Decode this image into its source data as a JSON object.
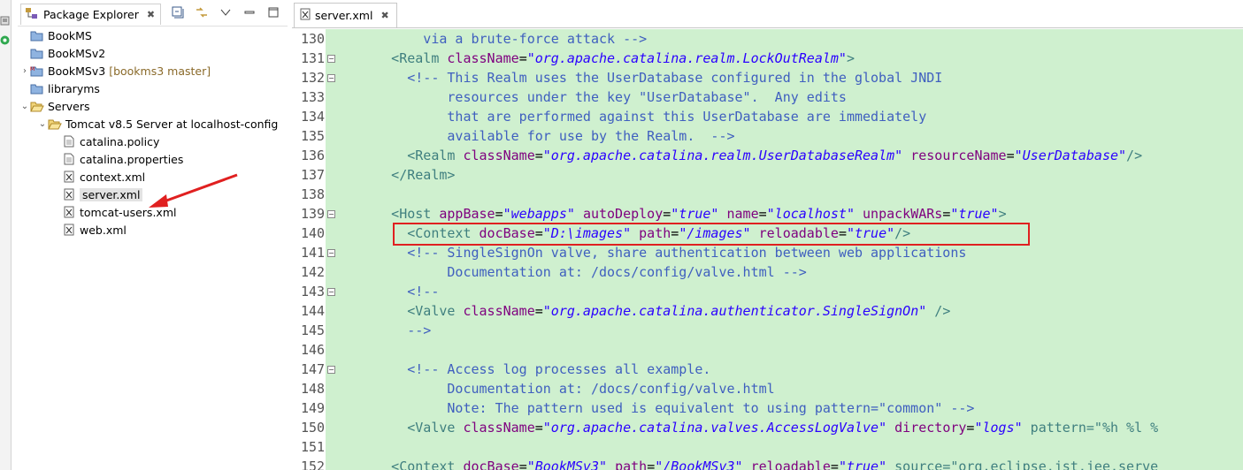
{
  "left_strip": {
    "icons": [
      "launch-icon",
      "run-status-icon"
    ]
  },
  "package_explorer": {
    "title": "Package Explorer",
    "close": "✖",
    "toolbar": [
      "collapse-all-icon",
      "link-editor-icon",
      "view-menu-icon",
      "minimize-icon",
      "maximize-icon"
    ],
    "tree": [
      {
        "label": "BookMS",
        "icon": "project-folder-icon",
        "decor": ""
      },
      {
        "label": "BookMSv2",
        "icon": "project-folder-icon",
        "decor": ""
      },
      {
        "label": "BookMSv3",
        "icon": "maven-project-icon",
        "decor": "[bookms3 master]"
      },
      {
        "label": "libraryms",
        "icon": "project-folder-icon",
        "decor": ""
      },
      {
        "label": "Servers",
        "icon": "open-folder-icon",
        "decor": ""
      },
      {
        "label": "Tomcat v8.5 Server at localhost-config",
        "icon": "open-folder-icon",
        "decor": ""
      },
      {
        "label": "catalina.policy",
        "icon": "file-icon",
        "decor": ""
      },
      {
        "label": "catalina.properties",
        "icon": "file-icon",
        "decor": ""
      },
      {
        "label": "context.xml",
        "icon": "xml-file-icon",
        "decor": ""
      },
      {
        "label": "server.xml",
        "icon": "xml-file-icon",
        "decor": ""
      },
      {
        "label": "tomcat-users.xml",
        "icon": "xml-file-icon",
        "decor": ""
      },
      {
        "label": "web.xml",
        "icon": "xml-file-icon",
        "decor": ""
      }
    ]
  },
  "editor": {
    "tab_title": "server.xml",
    "close": "✖",
    "lines": [
      {
        "n": "130",
        "fold": false,
        "text": "          via a brute-force attack -->"
      },
      {
        "n": "131",
        "fold": true,
        "text": "      <Realm className=\"org.apache.catalina.realm.LockOutRealm\">"
      },
      {
        "n": "132",
        "fold": true,
        "text": "        <!-- This Realm uses the UserDatabase configured in the global JNDI"
      },
      {
        "n": "133",
        "fold": false,
        "text": "             resources under the key \"UserDatabase\".  Any edits"
      },
      {
        "n": "134",
        "fold": false,
        "text": "             that are performed against this UserDatabase are immediately"
      },
      {
        "n": "135",
        "fold": false,
        "text": "             available for use by the Realm.  -->"
      },
      {
        "n": "136",
        "fold": false,
        "text": "        <Realm className=\"org.apache.catalina.realm.UserDatabaseRealm\" resourceName=\"UserDatabase\"/>"
      },
      {
        "n": "137",
        "fold": false,
        "text": "      </Realm>"
      },
      {
        "n": "138",
        "fold": false,
        "text": ""
      },
      {
        "n": "139",
        "fold": true,
        "text": "      <Host appBase=\"webapps\" autoDeploy=\"true\" name=\"localhost\" unpackWARs=\"true\">"
      },
      {
        "n": "140",
        "fold": false,
        "text": "        <Context docBase=\"D:\\images\" path=\"/images\" reloadable=\"true\"/>"
      },
      {
        "n": "141",
        "fold": true,
        "text": "        <!-- SingleSignOn valve, share authentication between web applications"
      },
      {
        "n": "142",
        "fold": false,
        "text": "             Documentation at: /docs/config/valve.html -->"
      },
      {
        "n": "143",
        "fold": true,
        "text": "        <!--"
      },
      {
        "n": "144",
        "fold": false,
        "text": "        <Valve className=\"org.apache.catalina.authenticator.SingleSignOn\" />"
      },
      {
        "n": "145",
        "fold": false,
        "text": "        -->"
      },
      {
        "n": "146",
        "fold": false,
        "text": ""
      },
      {
        "n": "147",
        "fold": true,
        "text": "        <!-- Access log processes all example."
      },
      {
        "n": "148",
        "fold": false,
        "text": "             Documentation at: /docs/config/valve.html"
      },
      {
        "n": "149",
        "fold": false,
        "text": "             Note: The pattern used is equivalent to using pattern=\"common\" -->"
      },
      {
        "n": "150",
        "fold": false,
        "text": "        <Valve className=\"org.apache.catalina.valves.AccessLogValve\" directory=\"logs\" pattern=\"%h %l %"
      },
      {
        "n": "151",
        "fold": false,
        "text": ""
      },
      {
        "n": "152",
        "fold": false,
        "text": "      <Context docBase=\"BookMSv3\" path=\"/BookMSv3\" reloadable=\"true\" source=\"org.eclipse.jst.jee.serve"
      }
    ]
  },
  "colors": {
    "editor_bg": "#cff0cf",
    "comment": "#3f5fbf",
    "tag": "#3f7f7f",
    "attribute": "#7f007f",
    "value": "#2a00ff",
    "highlight_box": "#e02020",
    "arrow": "#e02020"
  }
}
